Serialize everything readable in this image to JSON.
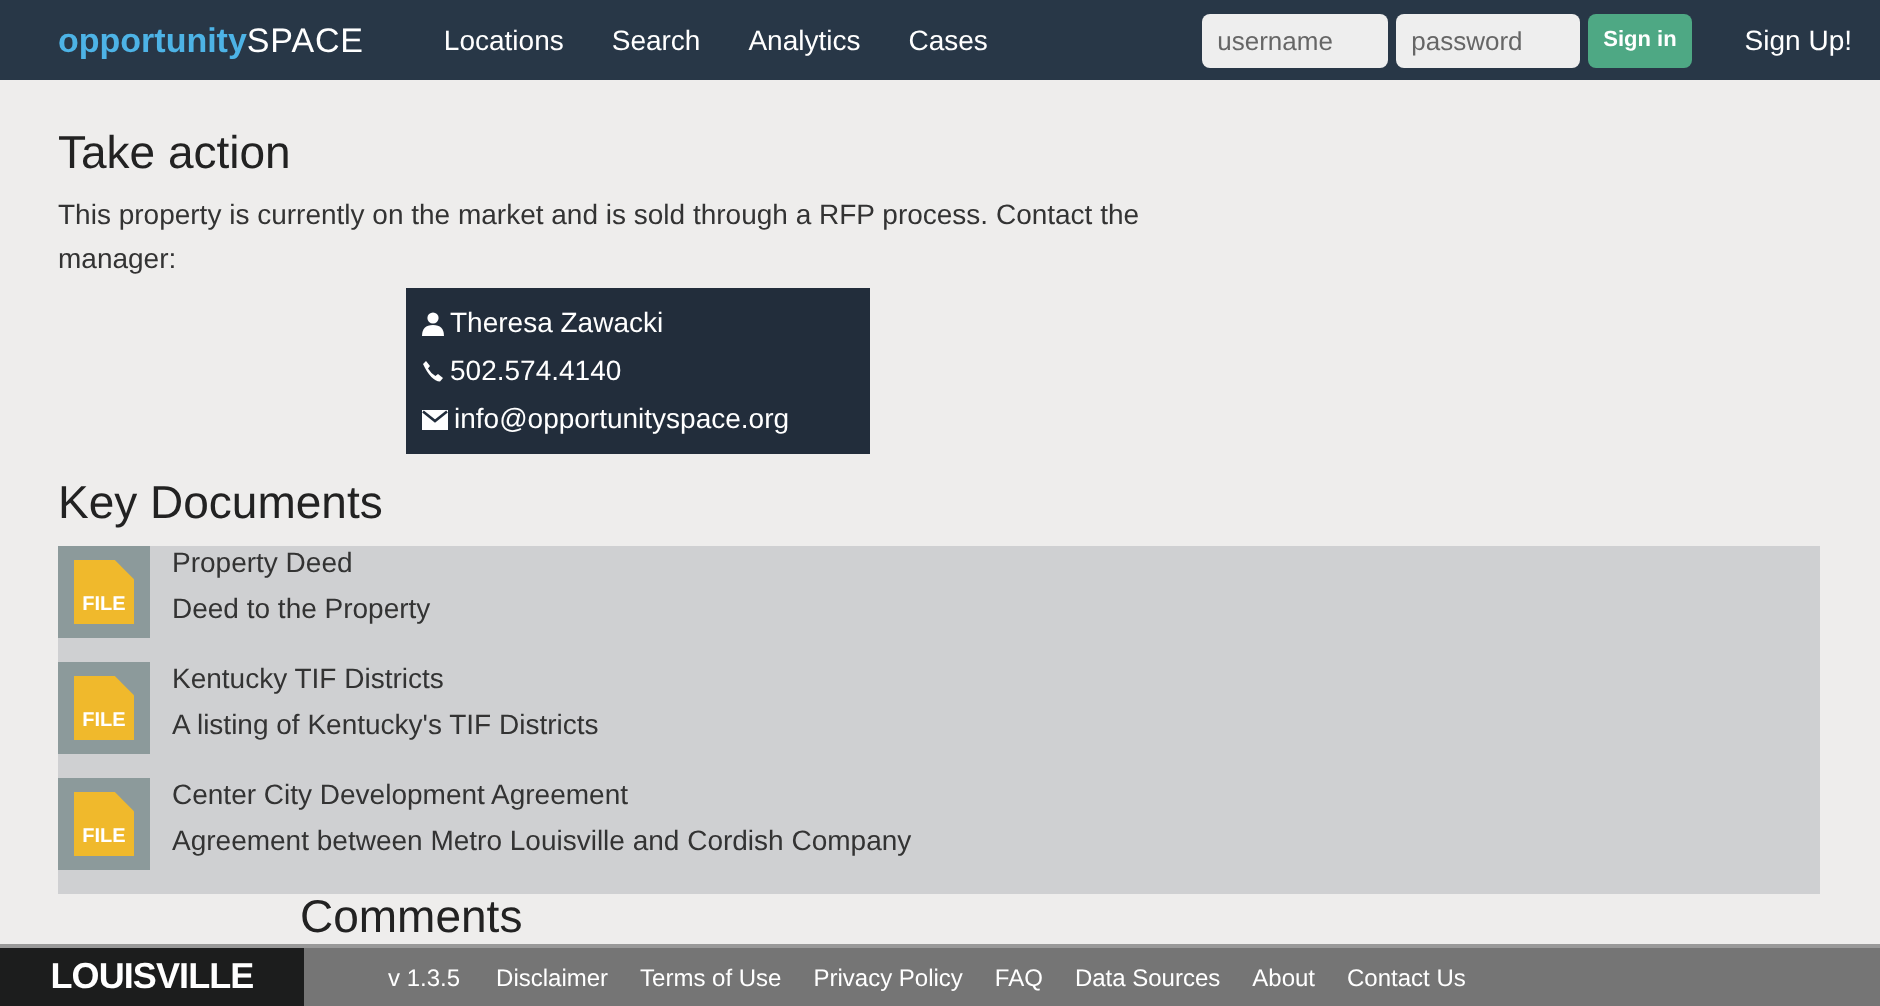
{
  "navbar": {
    "logo": {
      "first": "opportunity",
      "second": "SPACE"
    },
    "links": [
      "Locations",
      "Search",
      "Analytics",
      "Cases"
    ],
    "username": {
      "placeholder": "username"
    },
    "password": {
      "placeholder": "password"
    },
    "sign_in": "Sign in",
    "sign_up": "Sign Up!"
  },
  "take_action": {
    "title": "Take action",
    "text": "This property is currently on the market and is sold through a RFP process. Contact the manager:",
    "contact": {
      "name": "Theresa Zawacki",
      "phone": "502.574.4140",
      "email": "info@opportunityspace.org"
    }
  },
  "key_documents": {
    "title": "Key Documents",
    "items": [
      {
        "icon_text": "FILE",
        "title": "Property Deed",
        "description": "Deed to the Property"
      },
      {
        "icon_text": "FILE",
        "title": "Kentucky TIF Districts",
        "description": "A listing of Kentucky's TIF Districts"
      },
      {
        "icon_text": "FILE",
        "title": "Center City Development Agreement",
        "description": "Agreement between Metro Louisville and Cordish Company"
      }
    ]
  },
  "comments": {
    "title": "Comments"
  },
  "footer": {
    "logo": "LOUISVILLE",
    "version": "v 1.3.5",
    "links": [
      "Disclaimer",
      "Terms of Use",
      "Privacy Policy",
      "FAQ",
      "Data Sources",
      "About",
      "Contact Us"
    ]
  }
}
